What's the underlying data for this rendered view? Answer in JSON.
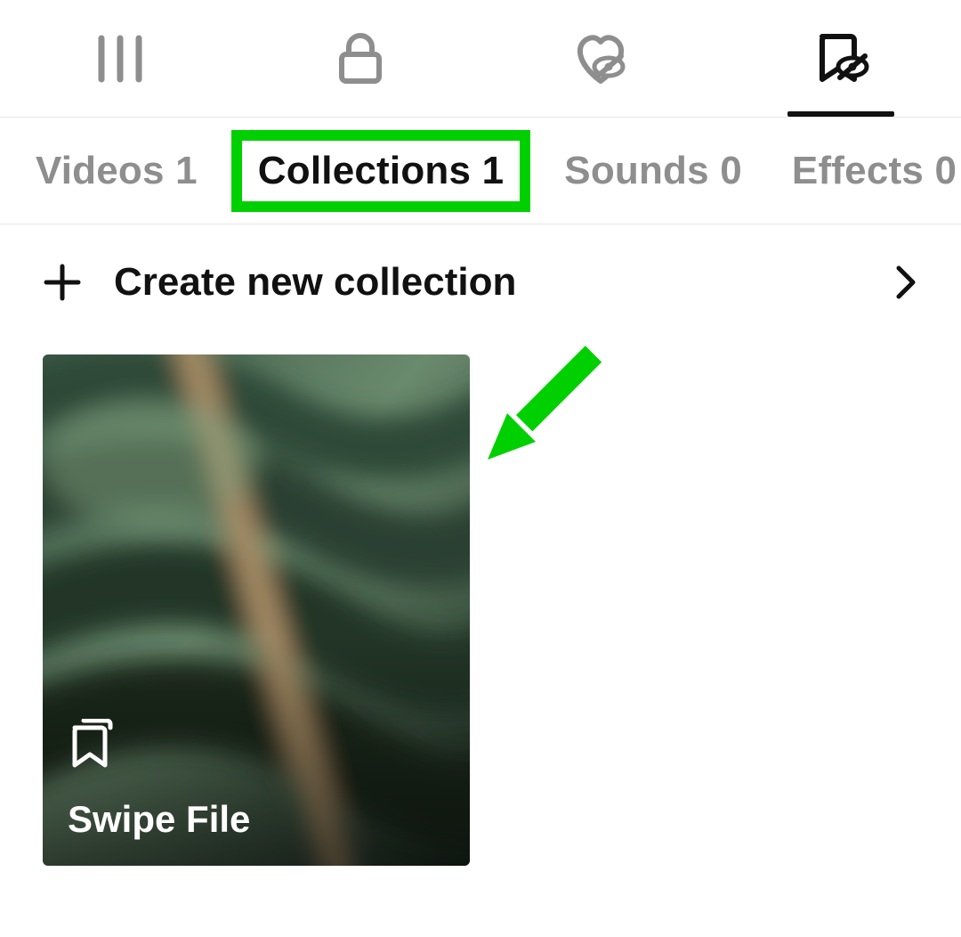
{
  "iconTabs": {
    "activeIndex": 3
  },
  "textTabs": {
    "videos": {
      "label": "Videos",
      "count": "1"
    },
    "collections": {
      "label": "Collections",
      "count": "1"
    },
    "sounds": {
      "label": "Sounds",
      "count": "0"
    },
    "effects": {
      "label": "Effects",
      "count": "0"
    },
    "activeKey": "collections"
  },
  "create": {
    "label": "Create new collection"
  },
  "collections": [
    {
      "title": "Swipe File"
    }
  ],
  "annotation": {
    "highlightColor": "#00d000"
  }
}
